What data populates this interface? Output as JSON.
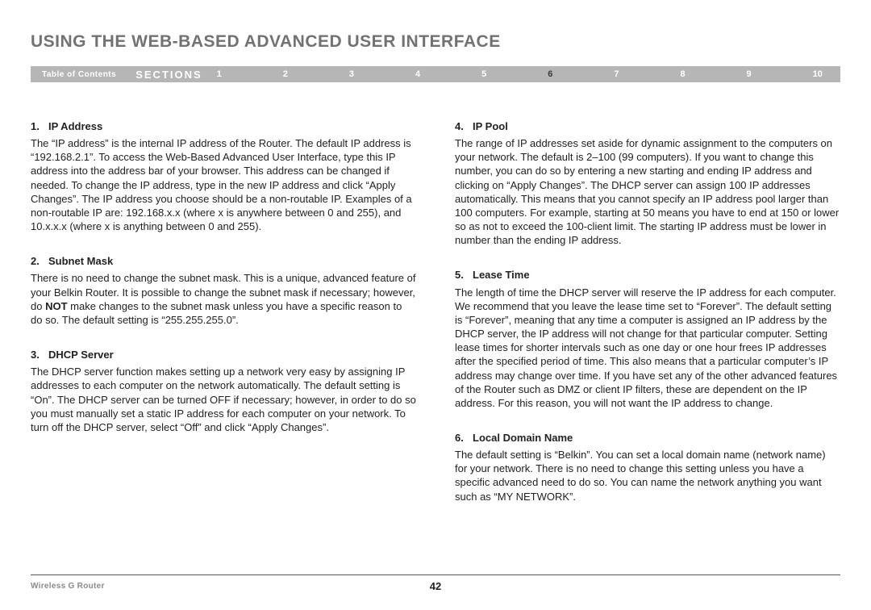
{
  "title": "USING THE WEB-BASED ADVANCED USER INTERFACE",
  "nav": {
    "toc": "Table of Contents",
    "sections_label": "SECTIONS",
    "numbers": [
      "1",
      "2",
      "3",
      "4",
      "5",
      "6",
      "7",
      "8",
      "9",
      "10"
    ],
    "active": "6"
  },
  "left": [
    {
      "num": "1.",
      "heading": "IP Address",
      "body": "The “IP address” is the internal IP address of the Router. The default IP address is “192.168.2.1”. To access the Web-Based Advanced User Interface, type this IP address into the address bar of your browser. This address can be changed if needed. To change the IP address, type in the new IP address and click “Apply Changes”. The IP address you choose should be a non-routable IP. Examples of a non-routable IP are: 192.168.x.x (where x is anywhere between 0 and 255), and 10.x.x.x (where x is anything between 0 and 255)."
    },
    {
      "num": "2.",
      "heading": "Subnet Mask",
      "body_pre": "There is no need to change the subnet mask. This is a unique, advanced feature of your Belkin Router. It is possible to change the subnet mask if necessary; however, do ",
      "body_bold": "NOT",
      "body_post": " make changes to the subnet mask unless you have a specific reason to do so. The default setting is “255.255.255.0”."
    },
    {
      "num": "3.",
      "heading": "DHCP Server",
      "body": "The DHCP server function makes setting up a network very easy by assigning IP addresses to each computer on the network automatically. The default setting is “On”. The DHCP server can be turned OFF if necessary; however, in order to do so you must manually set a static IP address for each computer on your network. To turn off the DHCP server, select “Off” and click “Apply Changes”."
    }
  ],
  "right": [
    {
      "num": "4.",
      "heading": "IP Pool",
      "body": "The range of IP addresses set aside for dynamic assignment to the computers on your network. The default is 2–100 (99 computers). If you want to change this number, you can do so by entering a new starting and ending IP address and clicking on “Apply Changes”. The DHCP server can assign 100 IP addresses automatically. This means that you cannot specify an IP address pool larger than 100 computers. For example, starting at 50 means you have to end at 150 or lower so as not to exceed the 100-client limit. The starting IP address must be lower in number than the ending IP address."
    },
    {
      "num": "5.",
      "heading": "Lease Time",
      "body": "The length of time the DHCP server will reserve the IP address for each computer. We recommend that you leave the lease time set to “Forever”. The default setting is “Forever”, meaning that any time a computer is assigned an IP address by the DHCP server, the IP address will not change for that particular computer. Setting lease times for shorter intervals such as one day or one hour frees IP addresses after the specified period of time. This also means that a particular computer’s IP address may change over time. If you have set any of the other advanced features of the Router such as DMZ or client IP filters, these are dependent on the IP address. For this reason, you will not want the IP address to change."
    },
    {
      "num": "6.",
      "heading": "Local Domain Name",
      "body": "The default setting is “Belkin”. You can set a local domain name (network name) for your network. There is no need to change this setting unless you have a specific advanced need to do so. You can name the network anything you want such as “MY NETWORK”."
    }
  ],
  "footer": {
    "product": "Wireless G Router",
    "page": "42"
  }
}
